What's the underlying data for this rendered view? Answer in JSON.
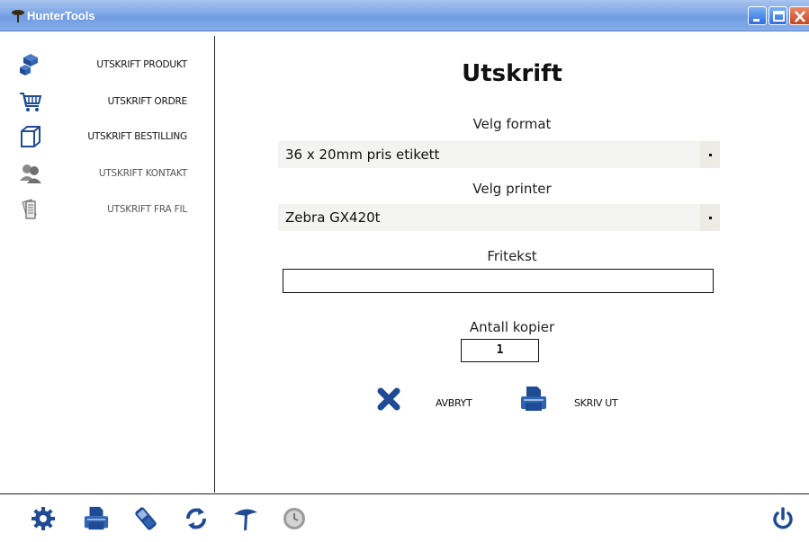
{
  "window": {
    "title": "HunterTools",
    "icon": "tree-icon"
  },
  "sidebar": {
    "items": [
      {
        "label": "UTSKRIFT PRODUKT",
        "icon": "boxes-icon",
        "enabled": true
      },
      {
        "label": "UTSKRIFT ORDRE",
        "icon": "cart-icon",
        "enabled": true
      },
      {
        "label": "UTSKRIFT BESTILLING",
        "icon": "box-outline-icon",
        "enabled": true
      },
      {
        "label": "UTSKRIFT KONTAKT",
        "icon": "users-icon",
        "enabled": false
      },
      {
        "label": "UTSKRIFT FRA FIL",
        "icon": "documents-icon",
        "enabled": false
      }
    ]
  },
  "main": {
    "title": "Utskrift",
    "format": {
      "label": "Velg format",
      "value": "36 x 20mm pris etikett"
    },
    "printer": {
      "label": "Velg printer",
      "value": "Zebra  GX420t"
    },
    "freetext": {
      "label": "Fritekst",
      "value": ""
    },
    "copies": {
      "label": "Antall kopier",
      "value": "1"
    },
    "cancel_label": "AVBRYT",
    "print_label": "SKRIV UT"
  },
  "toolbar": {
    "buttons": [
      "gear-icon",
      "printer-icon",
      "phone-icon",
      "refresh-icon",
      "tree-icon",
      "clock-icon"
    ],
    "power": "power-icon"
  },
  "colors": {
    "accent_blue": "#1f4a94",
    "titlebar": "#7ea6e6",
    "close_red": "#c7451e"
  }
}
